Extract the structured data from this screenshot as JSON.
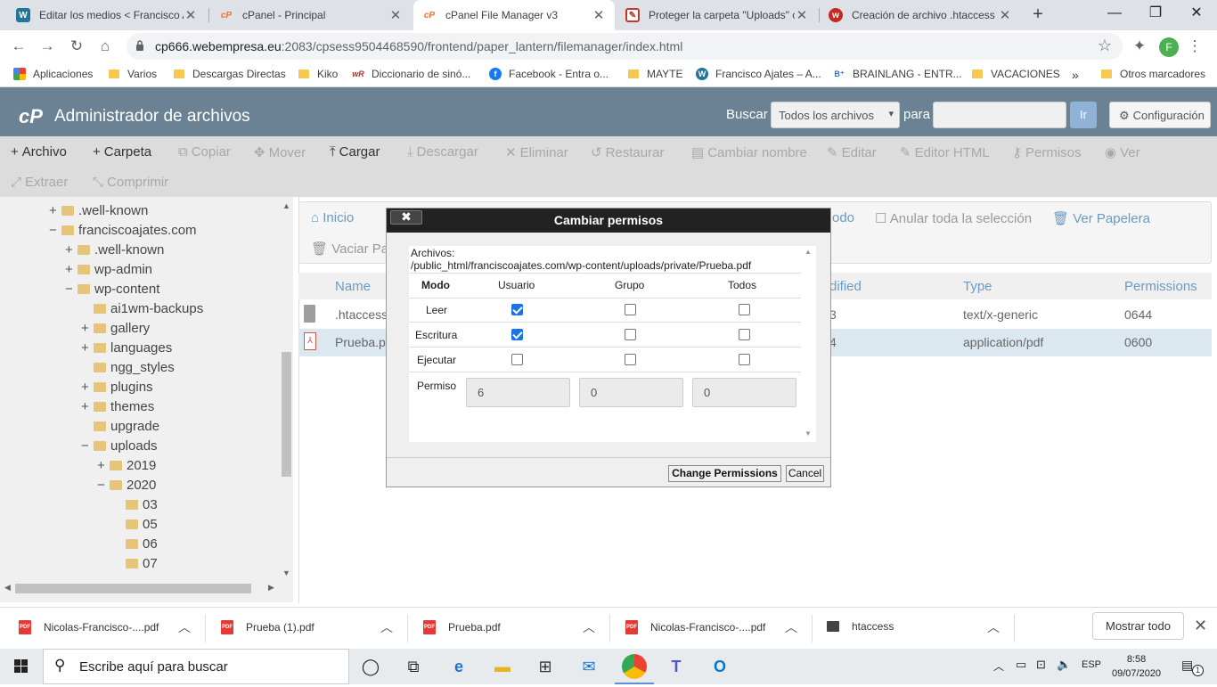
{
  "browser": {
    "tabs": [
      {
        "title": "Editar los medios < Francisco A",
        "icon": "wordpress-icon",
        "active": false
      },
      {
        "title": "cPanel - Principal",
        "icon": "cpanel-icon",
        "active": false
      },
      {
        "title": "cPanel File Manager v3",
        "icon": "cpanel-icon",
        "active": true
      },
      {
        "title": "Proteger la carpeta \"Uploads\" c",
        "icon": "page-icon",
        "active": false
      },
      {
        "title": "Creación de archivo .htaccess",
        "icon": "webempresa-icon",
        "active": false
      }
    ],
    "url_host": "cp666.webempresa.eu",
    "url_rest": ":2083/cpsess9504468590/frontend/paper_lantern/filemanager/index.html",
    "profile_initial": "F",
    "bookmarks": [
      "Aplicaciones",
      "Varios",
      "Descargas Directas",
      "Kiko",
      "Diccionario de sinó...",
      "Facebook - Entra o...",
      "MAYTE",
      "Francisco Ajates – A...",
      "BRAINLANG - ENTR...",
      "VACACIONES",
      "Otros marcadores"
    ],
    "bookmarks_more": "»"
  },
  "header": {
    "logo": "cP",
    "title": "Administrador de archivos",
    "search_label": "Buscar",
    "search_scope": "Todos los archivos",
    "para_label": "para",
    "go_label": "Ir",
    "config_label": "Configuración"
  },
  "toolbar": {
    "row1": [
      {
        "label": "Archivo",
        "icon": "+",
        "enabled": true
      },
      {
        "label": "Carpeta",
        "icon": "+",
        "enabled": true
      },
      {
        "label": "Copiar",
        "icon": "⧉",
        "enabled": false
      },
      {
        "label": "Mover",
        "icon": "✥",
        "enabled": false
      },
      {
        "label": "Cargar",
        "icon": "⤒",
        "enabled": true
      },
      {
        "label": "Descargar",
        "icon": "⤓",
        "enabled": false
      },
      {
        "label": "Eliminar",
        "icon": "✕",
        "enabled": false
      },
      {
        "label": "Restaurar",
        "icon": "↺",
        "enabled": false
      },
      {
        "label": "Cambiar nombre",
        "icon": "▤",
        "enabled": false
      },
      {
        "label": "Editar",
        "icon": "✎",
        "enabled": false
      },
      {
        "label": "Editor HTML",
        "icon": "✎",
        "enabled": false
      },
      {
        "label": "Permisos",
        "icon": "⚷",
        "enabled": false
      },
      {
        "label": "Ver",
        "icon": "◉",
        "enabled": false
      }
    ],
    "row2": [
      {
        "label": "Extraer",
        "icon": "⤢",
        "enabled": false
      },
      {
        "label": "Comprimir",
        "icon": "⤡",
        "enabled": false
      }
    ]
  },
  "tree": [
    {
      "label": ".well-known",
      "pm": "+"
    },
    {
      "label": "franciscoajates.com",
      "pm": "−"
    },
    {
      "label": ".well-known",
      "pm": "+"
    },
    {
      "label": "wp-admin",
      "pm": "+"
    },
    {
      "label": "wp-content",
      "pm": "−"
    },
    {
      "label": "ai1wm-backups",
      "pm": ""
    },
    {
      "label": "gallery",
      "pm": "+"
    },
    {
      "label": "languages",
      "pm": "+"
    },
    {
      "label": "ngg_styles",
      "pm": ""
    },
    {
      "label": "plugins",
      "pm": "+"
    },
    {
      "label": "themes",
      "pm": "+"
    },
    {
      "label": "upgrade",
      "pm": ""
    },
    {
      "label": "uploads",
      "pm": "−"
    },
    {
      "label": "2019",
      "pm": "+"
    },
    {
      "label": "2020",
      "pm": "−"
    },
    {
      "label": "03",
      "pm": ""
    },
    {
      "label": "05",
      "pm": ""
    },
    {
      "label": "06",
      "pm": ""
    },
    {
      "label": "07",
      "pm": ""
    }
  ],
  "main": {
    "home_label": "Inicio",
    "partial_all_label": "odo",
    "deselect_label": "Anular toda la selección",
    "trash_label": "Ver Papelera",
    "empty_trash_label": "Vaciar Pap",
    "columns": [
      "Name",
      "dified",
      "Type",
      "Permissions"
    ],
    "files": [
      {
        "name": ".htaccess",
        "modified": "3",
        "type": "text/x-generic",
        "perms": "0644",
        "selected": false
      },
      {
        "name": "Prueba.p",
        "modified": "4",
        "type": "application/pdf",
        "perms": "0600",
        "selected": true
      }
    ]
  },
  "modal": {
    "title": "Cambiar permisos",
    "close": "✖",
    "files_label": "Archivos:",
    "file_path": "/public_html/franciscoajates.com/wp-content/uploads/private/Prueba.pdf",
    "headers": [
      "Modo",
      "Usuario",
      "Grupo",
      "Todos"
    ],
    "rows": [
      {
        "label": "Leer",
        "checks": [
          true,
          false,
          false
        ]
      },
      {
        "label": "Escritura",
        "checks": [
          true,
          false,
          false
        ]
      },
      {
        "label": "Ejecutar",
        "checks": [
          false,
          false,
          false
        ]
      }
    ],
    "permiso_label": "Permiso",
    "permiso_values": [
      "6",
      "0",
      "0"
    ],
    "ok_label": "Change Permissions",
    "cancel_label": "Cancel"
  },
  "downloads": {
    "items": [
      "Nicolas-Francisco-....pdf",
      "Prueba (1).pdf",
      "Prueba.pdf",
      "Nicolas-Francisco-....pdf",
      "htaccess"
    ],
    "show_all": "Mostrar todo"
  },
  "taskbar": {
    "search_placeholder": "Escribe aquí para buscar",
    "lang": "ESP",
    "time": "8:58",
    "date": "09/07/2020",
    "notifications": "1"
  },
  "colors": {
    "cpanel_header": "#6a8294",
    "link_blue": "#6b9ac4",
    "selected_row": "#dbe8f0"
  }
}
